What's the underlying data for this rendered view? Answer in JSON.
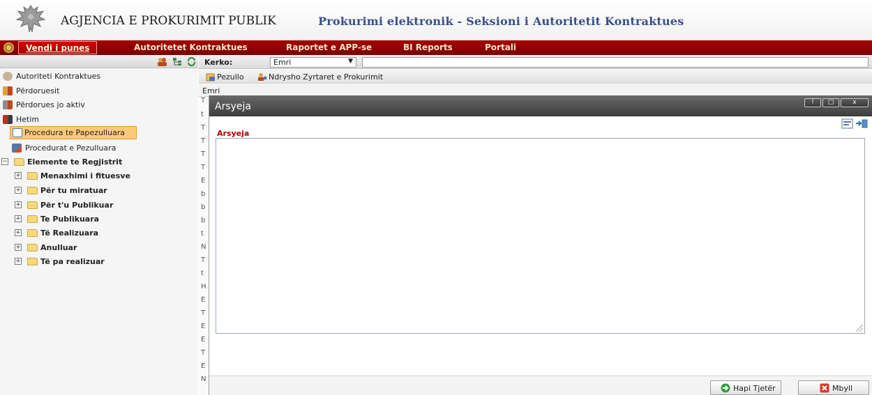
{
  "header": {
    "agency": "AGJENCIA E PROKURIMIT PUBLIK",
    "subtitle": "Prokurimi elektronik - Seksioni i Autoritetit Kontraktues",
    "emblem_icon": "albanian-eagle-emblem"
  },
  "nav": {
    "items": [
      {
        "label": "Vendi i punes",
        "active": true
      },
      {
        "label": "Autoritetet Kontraktues"
      },
      {
        "label": "Raportet e APP-se"
      },
      {
        "label": "BI Reports"
      },
      {
        "label": "Portali"
      }
    ],
    "accent": "#8b0000"
  },
  "tree": {
    "items": [
      {
        "label": "Autoriteti Kontraktues",
        "icon": "authority-icon"
      },
      {
        "label": "Përdoruesit",
        "icon": "users-icon"
      },
      {
        "label": "Përdorues jo aktiv",
        "icon": "inactive-users-icon"
      },
      {
        "label": "Hetim",
        "icon": "investigation-icon"
      },
      {
        "label": "Procedura te Papezulluara",
        "icon": "procedure-icon",
        "selected": true
      },
      {
        "label": "Procedurat e Pezulluara",
        "icon": "suspended-procedure-icon"
      },
      {
        "label": "Elemente te Regjistrit",
        "icon": "folder-icon",
        "expanded": true
      },
      {
        "label": "Menaxhimi i fituesve",
        "icon": "folder-icon"
      },
      {
        "label": "Për tu miratuar",
        "icon": "folder-icon"
      },
      {
        "label": "Për t'u Publikuar",
        "icon": "folder-icon"
      },
      {
        "label": "Te Publikuara",
        "icon": "folder-icon"
      },
      {
        "label": "Të Realizuara",
        "icon": "folder-icon"
      },
      {
        "label": "Anulluar",
        "icon": "folder-icon"
      },
      {
        "label": "Të pa realizuar",
        "icon": "folder-icon"
      }
    ]
  },
  "search": {
    "label": "Kerko:",
    "field_value": "Emri",
    "query": ""
  },
  "actions": {
    "pezullo": "Pezullo",
    "ndrysho": "Ndrysho Zyrtaret e Prokurimit"
  },
  "grid": {
    "column": "Emri",
    "row_initials": [
      "T",
      "t",
      "T",
      "T",
      "T",
      "T",
      "E",
      "b",
      "b",
      "b",
      "t",
      "N",
      "T",
      "t",
      "H",
      "E",
      "T",
      "E",
      "E",
      "T",
      "E",
      "N"
    ]
  },
  "dialog": {
    "title": "Arsyeja",
    "window_buttons": [
      "!",
      "□",
      "x"
    ],
    "field_label": "Arsyeja",
    "field_value": "",
    "buttons": {
      "next": "Hapi Tjetër",
      "close": "Mbyll"
    }
  }
}
